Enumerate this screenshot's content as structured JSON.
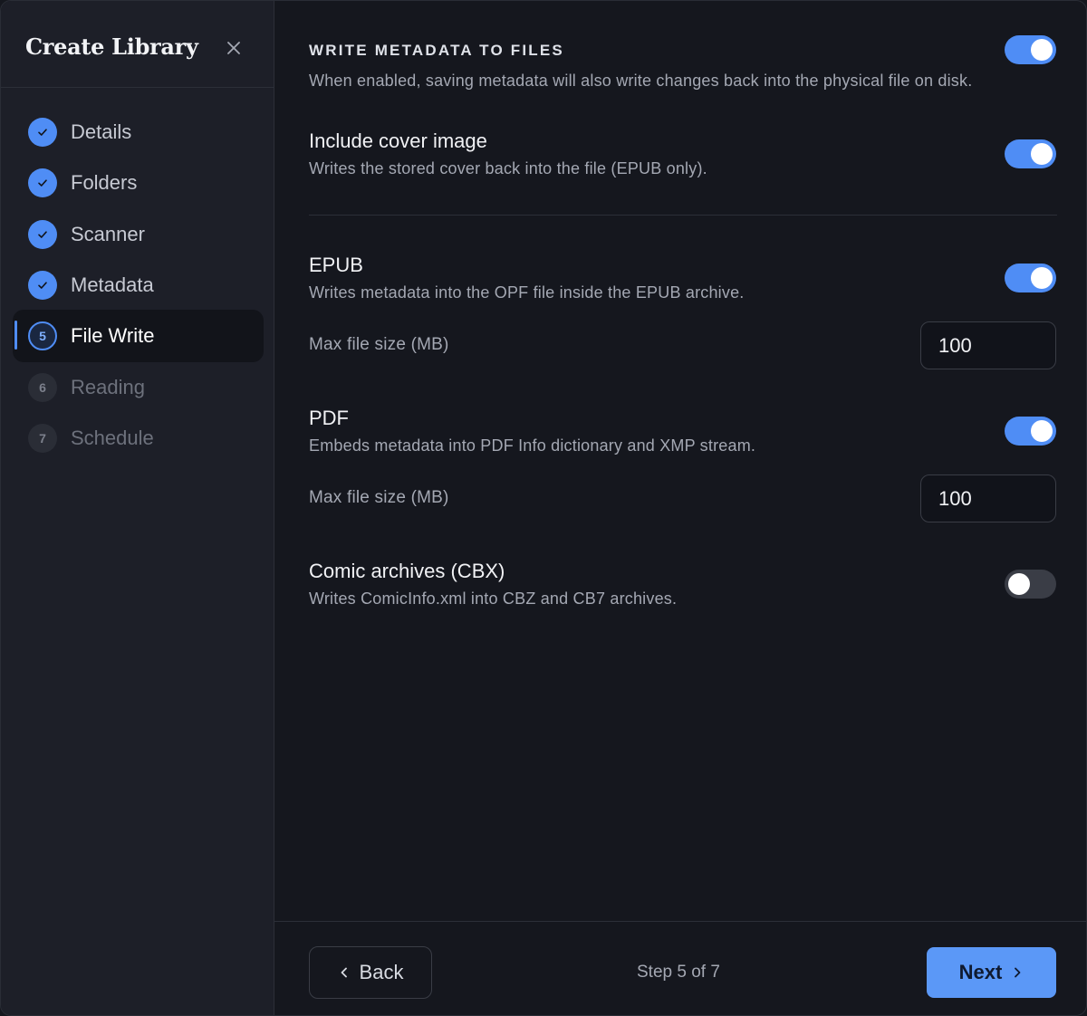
{
  "sidebar": {
    "title": "Create Library",
    "close_icon": "close-icon",
    "steps": [
      {
        "number": "1",
        "label": "Details",
        "status": "done"
      },
      {
        "number": "2",
        "label": "Folders",
        "status": "done"
      },
      {
        "number": "3",
        "label": "Scanner",
        "status": "done"
      },
      {
        "number": "4",
        "label": "Metadata",
        "status": "done"
      },
      {
        "number": "5",
        "label": "File Write",
        "status": "current"
      },
      {
        "number": "6",
        "label": "Reading",
        "status": "pending"
      },
      {
        "number": "7",
        "label": "Schedule",
        "status": "pending"
      }
    ]
  },
  "main": {
    "write_metadata": {
      "title": "WRITE METADATA TO FILES",
      "description": "When enabled, saving metadata will also write changes back into the physical file on disk.",
      "enabled": true
    },
    "cover_image": {
      "title": "Include cover image",
      "description": "Writes the stored cover back into the file (EPUB only).",
      "enabled": true
    },
    "epub": {
      "title": "EPUB",
      "description": "Writes metadata into the OPF file inside the EPUB archive.",
      "enabled": true,
      "max_size_label": "Max file size (MB)",
      "max_size_value": "100"
    },
    "pdf": {
      "title": "PDF",
      "description": "Embeds metadata into PDF Info dictionary and XMP stream.",
      "enabled": true,
      "max_size_label": "Max file size (MB)",
      "max_size_value": "100"
    },
    "cbx": {
      "title": "Comic archives (CBX)",
      "description": "Writes ComicInfo.xml into CBZ and CB7 archives.",
      "enabled": false
    }
  },
  "footer": {
    "back_label": "Back",
    "step_text": "Step 5 of 7",
    "next_label": "Next"
  },
  "colors": {
    "accent": "#4f8df5",
    "background": "#15171e",
    "sidebar": "#1d1f28"
  }
}
